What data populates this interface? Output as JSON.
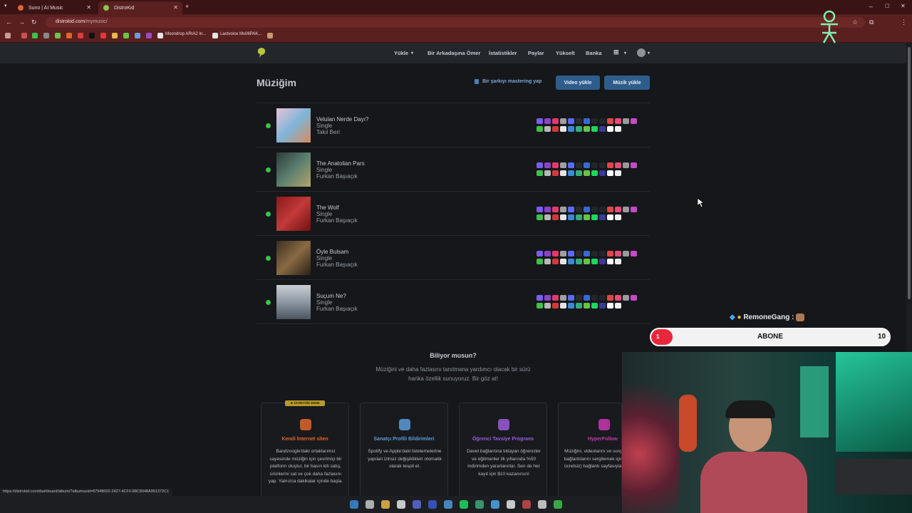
{
  "browser": {
    "tabs": [
      {
        "label": "Suno | AI Music",
        "fav_color": "#e0662a"
      },
      {
        "label": "DistroKid",
        "fav_color": "#8ac44a"
      }
    ],
    "url_domain": "distrokid.com",
    "url_path": "/mymusic/",
    "bookmarks": [
      "Moondrop ARIA2 In...",
      "Lastvoice Ms06PAK..."
    ],
    "status_url": "https://distrokid.com/dashboard/album/?albumuuid=87948002-2427-4CF0-88C8048A951372C1"
  },
  "nav": {
    "links": [
      "Yükle",
      "Bir Arkadaşına Ömer",
      "İstatistikler",
      "Paylar",
      "Yükselt",
      "Banka"
    ]
  },
  "page": {
    "title": "Müziğim",
    "master_link": "Bir şarkıyı mastering yap",
    "video_button": "Video yükle",
    "music_button": "Müzik yükle"
  },
  "releases": [
    {
      "title": "Velulan Nerde Dayı?",
      "type": "Single",
      "artist": "Takıl Beri",
      "art": "linear-gradient(135deg,#e9c2d9,#7fb5d9,#d78a5a)"
    },
    {
      "title": "The Anatolian Pars",
      "type": "Single",
      "artist": "Furkan Başıaçık",
      "art": "linear-gradient(135deg,#2d3b3a,#5a7f6f,#b5a56a)"
    },
    {
      "title": "The Wolf",
      "type": "Single",
      "artist": "Furkan Başıaçık",
      "art": "linear-gradient(135deg,#8e1818,#c23a3a,#6d1010)"
    },
    {
      "title": "Öyle Bulsam",
      "type": "Single",
      "artist": "Furkan Başıaçık",
      "art": "linear-gradient(135deg,#3b2f22,#8a6a42,#2a2018)"
    },
    {
      "title": "Suçum Ne?",
      "type": "Single",
      "artist": "Furkan Başıaçık",
      "art": "linear-gradient(180deg,#c9cfd6,#8c97a3,#4a5560)"
    }
  ],
  "store_colors_top": [
    "#7b5cf0",
    "#8a44c8",
    "#e03a6a",
    "#a0a0a0",
    "#5c6cf0",
    "#2a2a2a",
    "#3a6ad0",
    "#22262a",
    "#22262a",
    "#e04848",
    "#e84a7a",
    "#9a9a9a",
    "#c848c8"
  ],
  "store_colors_bottom": [
    "#3cc24a",
    "#b8b8b8",
    "#d03a3a",
    "#e6e6e6",
    "#3a8ad8",
    "#3ca87a",
    "#6ac24a",
    "#1ed760",
    "#3a3a9a",
    "#ffffff",
    "#f0f0f0"
  ],
  "know": {
    "title": "Biliyor musun?",
    "line1": "Müziğini ve daha fazlasını tanıtmana yardımcı olacak bir sürü",
    "line2": "harika özellik sunuyoruz. Bir göz at!",
    "badge": "★ ÜCRETSİZ DENE"
  },
  "cards": [
    {
      "title": "Kendi İnternet siten",
      "title_color": "#e0662a",
      "icon_color": "#e0662a",
      "body": "Bandzoogle'daki ortaklarımız sayesinde müziğin için çevrimiçi bir platform oluştur, bir basın kiti satış, ürünlerini sat ve çok daha fazlasını yap. Yalnızca dakikalar içinde başla."
    },
    {
      "title": "Sanatçı Profili Bildirimleri",
      "title_color": "#5d9bd8",
      "icon_color": "#5d9bd8",
      "body": "Spotify ve Apple'daki listelemelerine yapılan izinsiz değişiklikleri otomatik olarak tespit et."
    },
    {
      "title": "Öğrenci Tavsiye Programı",
      "title_color": "#9a5cd8",
      "icon_color": "#9a5cd8",
      "body": "Davet bağlantına tıklayan öğrenciler ve eğitmenler ilk yıllarında %50 indirimden yararlanırlar. Sen de her kayıt için $10 kazanırsın!"
    },
    {
      "title": "HyperFollow",
      "title_color": "#c838b0",
      "icon_color": "#c838b0",
      "body": "Müziğini, videolarını ve sosyal medya bağlantılarını sergilemek için basit (ve ücretsiz) bağlantı sayfasıyla yayınlan!"
    }
  ],
  "stream": {
    "chat_user": "RemoneGang :",
    "sub_current": "1",
    "sub_label": "ABONE",
    "sub_goal": "10",
    "sub_progress": 0.1
  }
}
